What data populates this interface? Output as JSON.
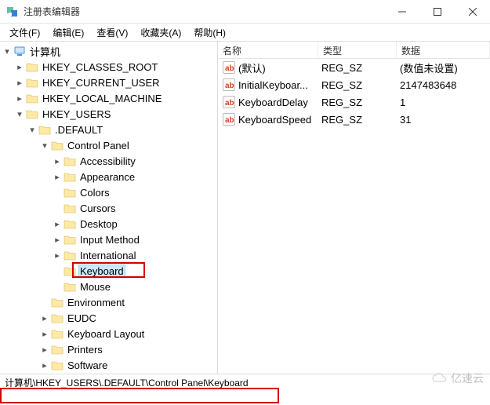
{
  "window": {
    "title": "注册表编辑器"
  },
  "menu": {
    "file": "文件(F)",
    "edit": "编辑(E)",
    "view": "查看(V)",
    "fav": "收藏夹(A)",
    "help": "帮助(H)"
  },
  "tree": {
    "root": "计算机",
    "hkcr": "HKEY_CLASSES_ROOT",
    "hkcu": "HKEY_CURRENT_USER",
    "hklm": "HKEY_LOCAL_MACHINE",
    "hku": "HKEY_USERS",
    "default": ".DEFAULT",
    "cpl": "Control Panel",
    "cpl_items": {
      "accessibility": "Accessibility",
      "appearance": "Appearance",
      "colors": "Colors",
      "cursors": "Cursors",
      "desktop": "Desktop",
      "input": "Input Method",
      "international": "International",
      "keyboard": "Keyboard",
      "mouse": "Mouse"
    },
    "env": "Environment",
    "eudc": "EUDC",
    "kblayout": "Keyboard Layout",
    "printers": "Printers",
    "software": "Software"
  },
  "columns": {
    "name": "名称",
    "type": "类型",
    "data": "数据"
  },
  "values": [
    {
      "name": "(默认)",
      "type": "REG_SZ",
      "data": "(数值未设置)"
    },
    {
      "name": "InitialKeyboar...",
      "type": "REG_SZ",
      "data": "2147483648"
    },
    {
      "name": "KeyboardDelay",
      "type": "REG_SZ",
      "data": "1"
    },
    {
      "name": "KeyboardSpeed",
      "type": "REG_SZ",
      "data": "31"
    }
  ],
  "statusbar": "计算机\\HKEY_USERS\\.DEFAULT\\Control Panel\\Keyboard",
  "watermark": "亿速云"
}
